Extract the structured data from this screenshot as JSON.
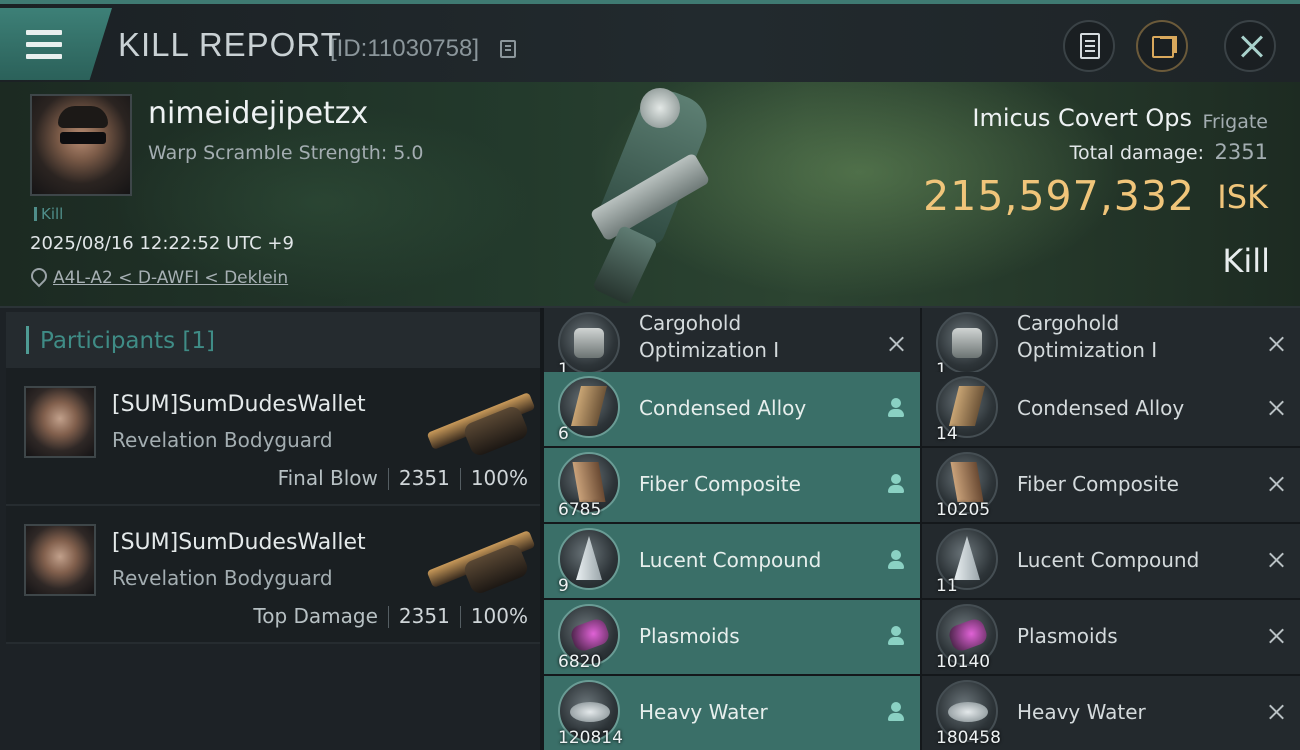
{
  "header": {
    "title": "KILL REPORT",
    "report_id": "[ID:11030758]"
  },
  "victim": {
    "pilot_name": "nimeidejipetzx",
    "warp_scramble": "Warp Scramble Strength: 5.0",
    "tag": "Kill",
    "timestamp": "2025/08/16 12:22:52 UTC +9",
    "location": "A4L-A2 < D-AWFI < Deklein",
    "ship_name": "Imicus Covert Ops",
    "ship_class": "Frigate",
    "total_damage_label": "Total damage:",
    "total_damage": "2351",
    "isk_value": "215,597,332",
    "isk_unit": "ISK",
    "result": "Kill"
  },
  "participants": {
    "title": "Participants [1]",
    "rows": [
      {
        "name": "[SUM]SumDudesWallet",
        "ship": "Revelation Bodyguard",
        "label": "Final Blow",
        "damage": "2351",
        "percent": "100%"
      },
      {
        "name": "[SUM]SumDudesWallet",
        "ship": "Revelation Bodyguard",
        "label": "Top Damage",
        "damage": "2351",
        "percent": "100%"
      }
    ]
  },
  "items": {
    "left": [
      {
        "name_line1": "Cargohold",
        "name_line2": "Optimization I",
        "qty": "1",
        "state": "destroyed",
        "icon": "cargo-module-icon"
      },
      {
        "name": "Condensed Alloy",
        "qty": "6",
        "state": "dropped",
        "icon": "condensed-alloy-icon"
      },
      {
        "name": "Fiber Composite",
        "qty": "6785",
        "state": "dropped",
        "icon": "fiber-composite-icon"
      },
      {
        "name": "Lucent Compound",
        "qty": "9",
        "state": "dropped",
        "icon": "lucent-compound-icon"
      },
      {
        "name": "Plasmoids",
        "qty": "6820",
        "state": "dropped",
        "icon": "plasmoids-icon"
      },
      {
        "name": "Heavy Water",
        "qty": "120814",
        "state": "dropped",
        "icon": "heavy-water-icon"
      }
    ],
    "right": [
      {
        "name_line1": "Cargohold",
        "name_line2": "Optimization I",
        "qty": "1",
        "state": "destroyed",
        "icon": "cargo-module-icon"
      },
      {
        "name": "Condensed Alloy",
        "qty": "14",
        "state": "destroyed",
        "icon": "condensed-alloy-icon"
      },
      {
        "name": "Fiber Composite",
        "qty": "10205",
        "state": "destroyed",
        "icon": "fiber-composite-icon"
      },
      {
        "name": "Lucent Compound",
        "qty": "11",
        "state": "destroyed",
        "icon": "lucent-compound-icon"
      },
      {
        "name": "Plasmoids",
        "qty": "10140",
        "state": "destroyed",
        "icon": "plasmoids-icon"
      },
      {
        "name": "Heavy Water",
        "qty": "180458",
        "state": "destroyed",
        "icon": "heavy-water-icon"
      }
    ]
  },
  "colors": {
    "accent": "#3f8c86",
    "dropped_row": "#3a6f68",
    "isk_gold": "#f0c57a"
  }
}
